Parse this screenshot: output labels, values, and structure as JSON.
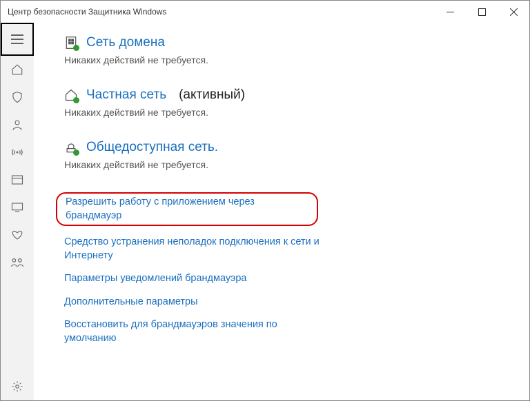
{
  "window": {
    "title": "Центр безопасности Защитника Windows"
  },
  "sections": {
    "domain": {
      "title": "Сеть домена",
      "sub": "Никаких действий не требуется."
    },
    "private": {
      "title": "Частная сеть",
      "active": "(активный)",
      "sub": "Никаких действий не требуется."
    },
    "public": {
      "title": "Общедоступная сеть.",
      "sub": "Никаких действий не требуется."
    }
  },
  "links": {
    "l1": "Разрешить работу с приложением через брандмауэр",
    "l2": "Средство устранения неполадок подключения к сети и Интернету",
    "l3": "Параметры уведомлений брандмауэра",
    "l4": "Дополнительные параметры",
    "l5": "Восстановить для брандмауэров значения по умолчанию"
  }
}
